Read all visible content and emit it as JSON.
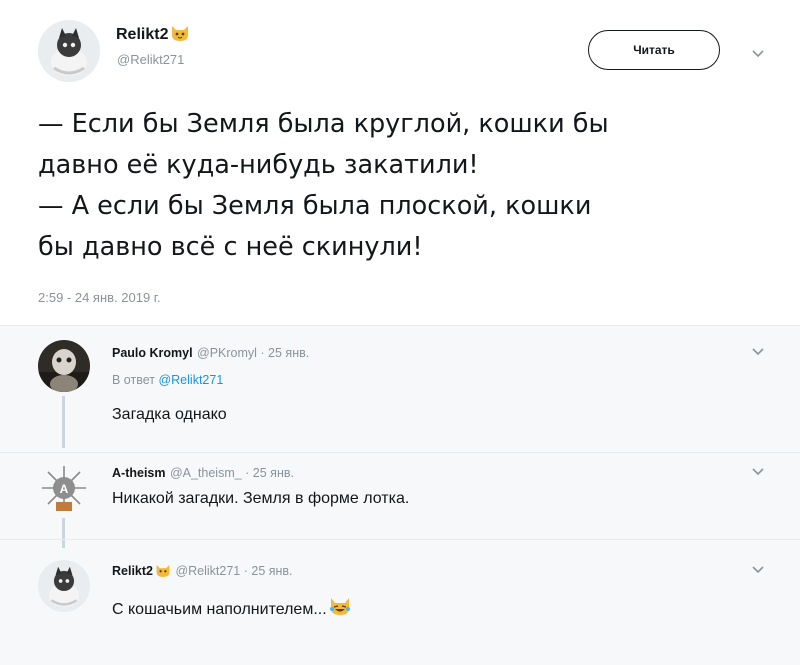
{
  "main_tweet": {
    "author_name": "Relikt2",
    "author_handle": "@Relikt271",
    "follow_label": "Читать",
    "text_lines": [
      "— Если бы Земля была круглой, кошки бы",
      "давно её куда-нибудь закатили!",
      "— А если бы Земля была плоской, кошки",
      "бы давно всё с неё скинули!"
    ],
    "timestamp": "2:59 - 24 янв. 2019 г."
  },
  "replies": [
    {
      "author_name": "Paulo Kromyl",
      "meta": "@PKromyl · 25 янв.",
      "reply_prefix": "В ответ",
      "reply_handle": "@Relikt271",
      "text": "Загадка однако"
    },
    {
      "author_name": "A-theism",
      "meta": "@A_theism_ · 25 янв.",
      "text": "Никакой загадки. Земля в форме лотка."
    },
    {
      "author_name": "Relikt2",
      "meta": "@Relikt271 · 25 янв.",
      "text": "С кошачьим наполнителем..."
    }
  ],
  "colors": {
    "link": "#1b95e0",
    "secondary_text": "#8a939b",
    "divider": "#e6ecf0",
    "reply_bg": "#f6f8f9"
  },
  "icons": [
    "cat-emoji-icon",
    "chevron-down-icon",
    "laughing-cat-emoji-icon"
  ]
}
